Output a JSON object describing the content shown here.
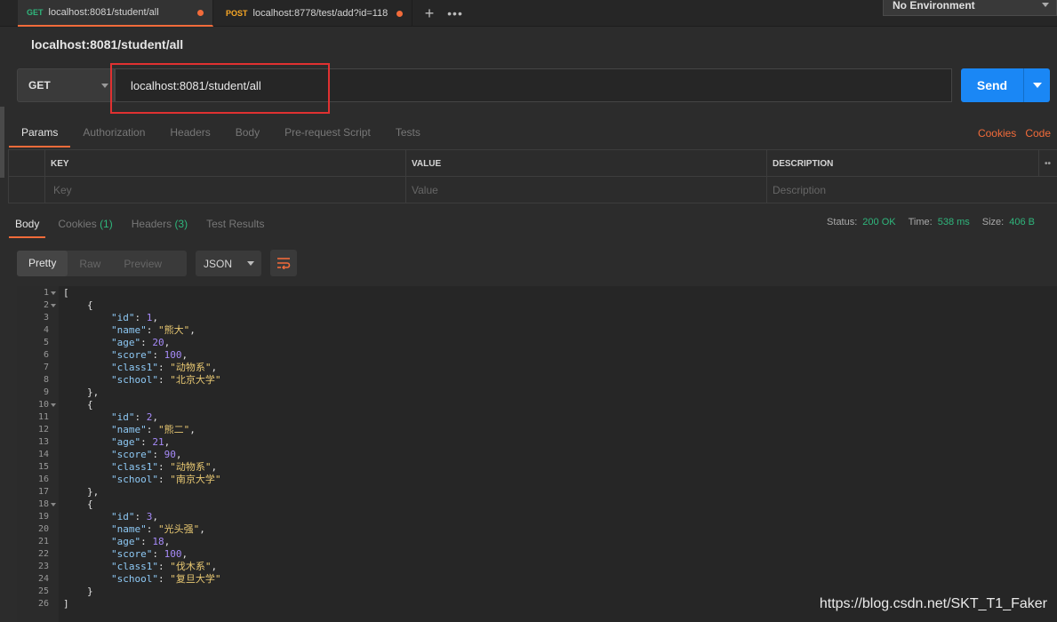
{
  "tabs": [
    {
      "method": "GET",
      "url": "localhost:8081/student/all"
    },
    {
      "method": "POST",
      "url": "localhost:8778/test/add?id=118"
    }
  ],
  "environment": "No Environment",
  "request": {
    "title": "localhost:8081/student/all",
    "method": "GET",
    "url": "localhost:8081/student/all",
    "send_label": "Send"
  },
  "request_tabs": [
    "Params",
    "Authorization",
    "Headers",
    "Body",
    "Pre-request Script",
    "Tests"
  ],
  "request_links": [
    "Cookies",
    "Code"
  ],
  "params_table": {
    "headers": [
      "KEY",
      "VALUE",
      "DESCRIPTION"
    ],
    "placeholders": [
      "Key",
      "Value",
      "Description"
    ]
  },
  "response_tabs": [
    {
      "label": "Body",
      "count": ""
    },
    {
      "label": "Cookies",
      "count": "(1)"
    },
    {
      "label": "Headers",
      "count": "(3)"
    },
    {
      "label": "Test Results",
      "count": ""
    }
  ],
  "status": {
    "status_label": "Status:",
    "status_value": "200 OK",
    "time_label": "Time:",
    "time_value": "538 ms",
    "size_label": "Size:",
    "size_value": "406 B"
  },
  "view_modes": [
    "Pretty",
    "Raw",
    "Preview"
  ],
  "language": "JSON",
  "students": [
    {
      "id": 1,
      "name": "熊大",
      "age": 20,
      "score": 100,
      "class1": "动物系",
      "school": "北京大学"
    },
    {
      "id": 2,
      "name": "熊二",
      "age": 21,
      "score": 90,
      "class1": "动物系",
      "school": "南京大学"
    },
    {
      "id": 3,
      "name": "光头强",
      "age": 18,
      "score": 100,
      "class1": "伐木系",
      "school": "复旦大学"
    }
  ],
  "watermark": "https://blog.csdn.net/SKT_T1_Faker",
  "colors": {
    "accent": "#f26b3a",
    "send": "#1a87f5",
    "success": "#2fb67c",
    "highlight": "#e03131"
  }
}
